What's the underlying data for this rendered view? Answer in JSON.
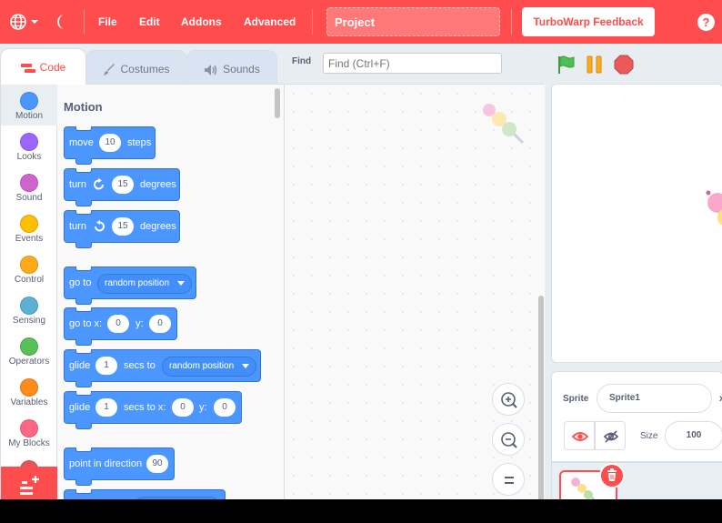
{
  "menubar": {
    "file": "File",
    "edit": "Edit",
    "addons": "Addons",
    "advanced": "Advanced",
    "project_title": "Project",
    "feedback": "TurboWarp Feedback",
    "help": "?"
  },
  "tabs": {
    "code": "Code",
    "costumes": "Costumes",
    "sounds": "Sounds"
  },
  "find": {
    "label": "Find",
    "placeholder": "Find (Ctrl+F)"
  },
  "categories": [
    {
      "label": "Motion",
      "color": "#4c97ff"
    },
    {
      "label": "Looks",
      "color": "#9966ff"
    },
    {
      "label": "Sound",
      "color": "#cf63cf"
    },
    {
      "label": "Events",
      "color": "#ffbf00"
    },
    {
      "label": "Control",
      "color": "#ffab19"
    },
    {
      "label": "Sensing",
      "color": "#5cb1d6"
    },
    {
      "label": "Operators",
      "color": "#59c059"
    },
    {
      "label": "Variables",
      "color": "#ff8c1a"
    },
    {
      "label": "My Blocks",
      "color": "#ff6680"
    }
  ],
  "palette": {
    "title": "Motion",
    "blocks": {
      "move": {
        "a": "move",
        "v": "10",
        "b": "steps"
      },
      "turn_right": {
        "a": "turn",
        "v": "15",
        "b": "degrees"
      },
      "turn_left": {
        "a": "turn",
        "v": "15",
        "b": "degrees"
      },
      "goto": {
        "a": "go to",
        "dd": "random position"
      },
      "goto_xy": {
        "a": "go to x:",
        "x": "0",
        "b": "y:",
        "y": "0"
      },
      "glide_to": {
        "a": "glide",
        "v": "1",
        "b": "secs to",
        "dd": "random position"
      },
      "glide_xy": {
        "a": "glide",
        "v": "1",
        "b": "secs to x:",
        "x": "0",
        "c": "y:",
        "y": "0"
      },
      "point_dir": {
        "a": "point in direction",
        "v": "90"
      }
    }
  },
  "sprite": {
    "sprite_label": "Sprite",
    "name": "Sprite1",
    "x_label": "x",
    "size_label": "Size",
    "size": "100"
  },
  "colors": {
    "brand": "#ff4c4c",
    "motion": "#4c97ff",
    "flag": "#4cbf56",
    "pause": "#ffab19",
    "stop": "#ec5959"
  }
}
